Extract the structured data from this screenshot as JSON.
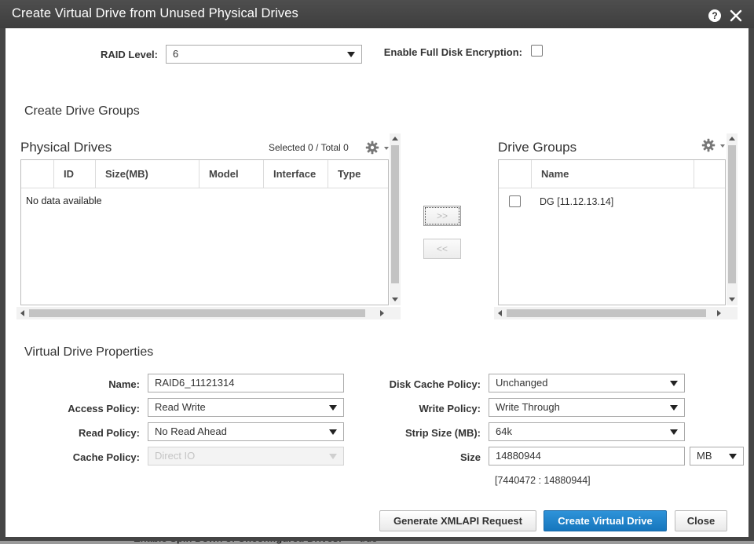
{
  "dialog": {
    "title": "Create Virtual Drive from Unused Physical Drives",
    "help_label": "?"
  },
  "raid": {
    "label": "RAID Level:",
    "value": "6",
    "encryption_label": "Enable Full Disk Encryption:",
    "encryption_checked": false
  },
  "create_groups": {
    "title": "Create Drive Groups"
  },
  "physical_drives": {
    "title": "Physical Drives",
    "selected_text": "Selected 0 / Total 0",
    "columns": [
      "ID",
      "Size(MB)",
      "Model",
      "Interface",
      "Type"
    ],
    "empty_text": "No data available"
  },
  "move": {
    "add_label": ">>",
    "remove_label": "<<"
  },
  "drive_groups": {
    "title": "Drive Groups",
    "columns": [
      "Name"
    ],
    "rows": [
      {
        "name": "DG [11.12.13.14]",
        "checked": false
      }
    ]
  },
  "vdp": {
    "title": "Virtual Drive Properties",
    "name_label": "Name:",
    "name_value": "RAID6_11121314",
    "access_label": "Access Policy:",
    "access_value": "Read Write",
    "read_label": "Read Policy:",
    "read_value": "No Read Ahead",
    "cache_label": "Cache Policy:",
    "cache_value": "Direct IO",
    "disk_cache_label": "Disk Cache Policy:",
    "disk_cache_value": "Unchanged",
    "write_label": "Write Policy:",
    "write_value": "Write Through",
    "strip_label": "Strip Size (MB):",
    "strip_value": "64k",
    "size_label": "Size",
    "size_value": "14880944",
    "size_unit": "MB",
    "size_range": "[7440472 : 14880944]"
  },
  "footer": {
    "generate_label": "Generate XMLAPI Request",
    "create_label": "Create Virtual Drive",
    "close_label": "Close"
  },
  "background": {
    "partial_label": "Enable Spin Down of Unconfigured Drives:",
    "partial_value": "true"
  },
  "colors": {
    "titlebar": "#454545",
    "primary_button": "#1c7fc8"
  }
}
